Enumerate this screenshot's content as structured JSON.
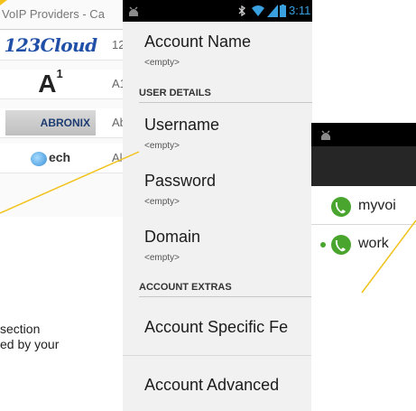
{
  "left_phone": {
    "breadcrumb": "VoIP Providers - Ca",
    "providers": [
      {
        "logo_text": "123Cloud",
        "name": "12"
      },
      {
        "logo_text": "A",
        "logo_sup": "1",
        "name": "A1"
      },
      {
        "logo_text": "ABRONIX",
        "name": "Ab"
      },
      {
        "logo_text": "ech",
        "name": "Al"
      }
    ]
  },
  "caption": {
    "line1": "section",
    "line2": "ed by your"
  },
  "mid_phone": {
    "status_time": "3:11",
    "account_name": {
      "title": "Account Name",
      "value": "<empty>"
    },
    "section_user_details": "USER DETAILS",
    "username": {
      "title": "Username",
      "value": "<empty>"
    },
    "password": {
      "title": "Password",
      "value": "<empty>"
    },
    "domain": {
      "title": "Domain",
      "value": "<empty>"
    },
    "section_account_extras": "ACCOUNT EXTRAS",
    "account_specific": "Account Specific Fe",
    "account_advanced": "Account Advanced"
  },
  "right_phone": {
    "accounts": [
      {
        "label": "myvoi",
        "active": false
      },
      {
        "label": "work",
        "active": true
      }
    ]
  },
  "colors": {
    "accent_green": "#4aa52e",
    "callout_line": "#f2c21b",
    "status_bar": "#000000",
    "action_bar": "#262626",
    "signal_blue": "#3aa0e0"
  }
}
